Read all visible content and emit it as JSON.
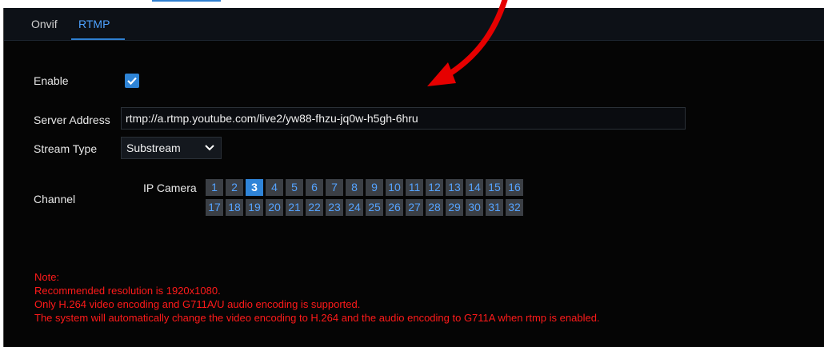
{
  "tabs": [
    {
      "label": "Onvif",
      "active": false
    },
    {
      "label": "RTMP",
      "active": true
    }
  ],
  "form": {
    "enable_label": "Enable",
    "enable_checked": true,
    "server_address_label": "Server Address",
    "server_address_value": "rtmp://a.rtmp.youtube.com/live2/yw88-fhzu-jq0w-h5gh-6hru",
    "stream_type_label": "Stream Type",
    "stream_type_value": "Substream",
    "channel_label": "Channel",
    "ip_camera_label": "IP Camera",
    "channels_row1": [
      "1",
      "2",
      "3",
      "4",
      "5",
      "6",
      "7",
      "8",
      "9",
      "10",
      "11",
      "12",
      "13",
      "14",
      "15",
      "16"
    ],
    "channels_row2": [
      "17",
      "18",
      "19",
      "20",
      "21",
      "22",
      "23",
      "24",
      "25",
      "26",
      "27",
      "28",
      "29",
      "30",
      "31",
      "32"
    ],
    "selected_channel": "3"
  },
  "notes": [
    "Note:",
    "Recommended resolution is 1920x1080.",
    "Only H.264 video encoding and G711A/U audio encoding is supported.",
    "The system will automatically change the video encoding to H.264 and the audio encoding to G711A when rtmp is enabled."
  ],
  "colors": {
    "accent": "#2f84d8",
    "note": "#ff1a1a",
    "annotation_arrow": "#e60000"
  }
}
